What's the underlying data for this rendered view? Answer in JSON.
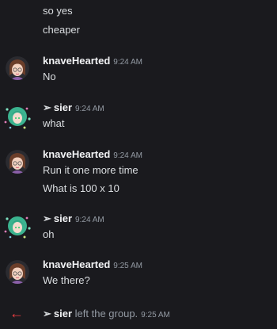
{
  "messages": {
    "m1": {
      "lines": [
        "so yes",
        "cheaper"
      ]
    },
    "m2": {
      "author": "knaveHearted",
      "time": "9:24 AM",
      "lines": [
        "No"
      ]
    },
    "m3": {
      "author": "sier",
      "prefix": "➢",
      "time": "9:24 AM",
      "lines": [
        "what"
      ]
    },
    "m4": {
      "author": "knaveHearted",
      "time": "9:24 AM",
      "lines": [
        "Run it one more time",
        "What is 100 x 10"
      ]
    },
    "m5": {
      "author": "sier",
      "prefix": "➢",
      "time": "9:24 AM",
      "lines": [
        "oh"
      ]
    },
    "m6": {
      "author": "knaveHearted",
      "time": "9:25 AM",
      "lines": [
        "We there?"
      ]
    }
  },
  "system": {
    "arrow": "←",
    "prefix": "➢",
    "name": "sier",
    "text": "left the group.",
    "time": "9:25 AM"
  },
  "colors": {
    "background": "#1a1a1e",
    "leave_arrow": "#f23f43"
  },
  "icons": {
    "knave_avatar": "knave-avatar",
    "sier_avatar": "sier-avatar",
    "leave": "leave-arrow-icon"
  }
}
